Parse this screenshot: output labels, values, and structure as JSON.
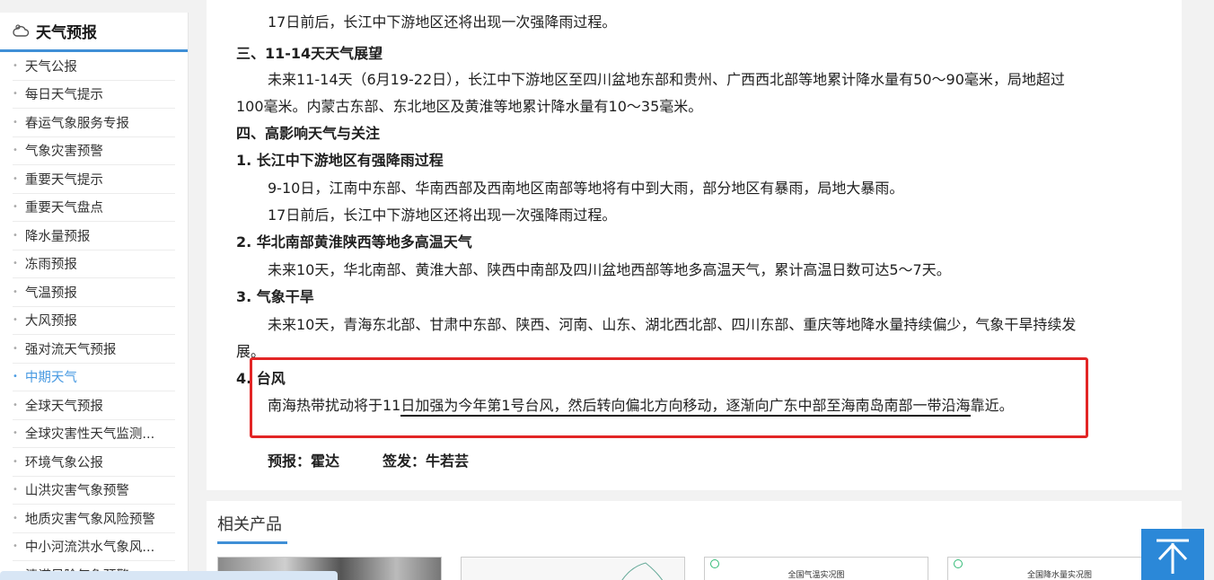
{
  "sidebar": {
    "title": "天气预报",
    "items": [
      "天气公报",
      "每日天气提示",
      "春运气象服务专报",
      "气象灾害预警",
      "重要天气提示",
      "重要天气盘点",
      "降水量预报",
      "冻雨预报",
      "气温预报",
      "大风预报",
      "强对流天气预报",
      "中期天气",
      "全球天气预报",
      "全球灾害性天气监测...",
      "环境气象公报",
      "山洪灾害气象预警",
      "地质灾害气象风险预警",
      "中小河流洪水气象风...",
      "渍涝风险气象预警"
    ],
    "active_index": 11,
    "accent": "#4a9be2"
  },
  "article": {
    "l0": "17日前后，长江中下游地区还将出现一次强降雨过程。",
    "h3": "三、11-14天天气展望",
    "p3a": "未来11-14天（6月19-22日），长江中下游地区至四川盆地东部和贵州、广西西北部等地累计降水量有50～90毫米，局地超过",
    "p3b": "100毫米。内蒙古东部、东北地区及黄淮等地累计降水量有10～35毫米。",
    "h4": "四、高影响天气与关注",
    "s1": "1. 长江中下游地区有强降雨过程",
    "s1a": "9-10日，江南中东部、华南西部及西南地区南部等地将有中到大雨，部分地区有暴雨，局地大暴雨。",
    "s1b": "17日前后，长江中下游地区还将出现一次强降雨过程。",
    "s2": "2. 华北南部黄淮陕西等地多高温天气",
    "s2a": "未来10天，华北南部、黄淮大部、陕西中南部及四川盆地西部等地多高温天气，累计高温日数可达5～7天。",
    "s3": "3. 气象干旱",
    "s3a": "未来10天，青海东北部、甘肃中东部、陕西、河南、山东、湖北西北部、四川东部、重庆等地降水量持续偏少，气象干旱持续发",
    "s3b": "展。",
    "s4": "4. 台风",
    "s4a_pre": "南海热带扰动将于11",
    "s4a_ul": "日加强为今年第1号台风，然后转向偏北方向移动，逐渐向广东中部至海南岛南部一带沿海",
    "s4a_post": "靠近。",
    "sign": "预报：霍达　　　签发：牛若芸"
  },
  "related": {
    "title": "相关产品",
    "thumbs": [
      "",
      "",
      "全国气温实况图",
      "全国降水量实况图"
    ]
  },
  "colors": {
    "highlight": "#e22525",
    "accent": "#3f8fd6",
    "back_top": "#2b88d8"
  }
}
